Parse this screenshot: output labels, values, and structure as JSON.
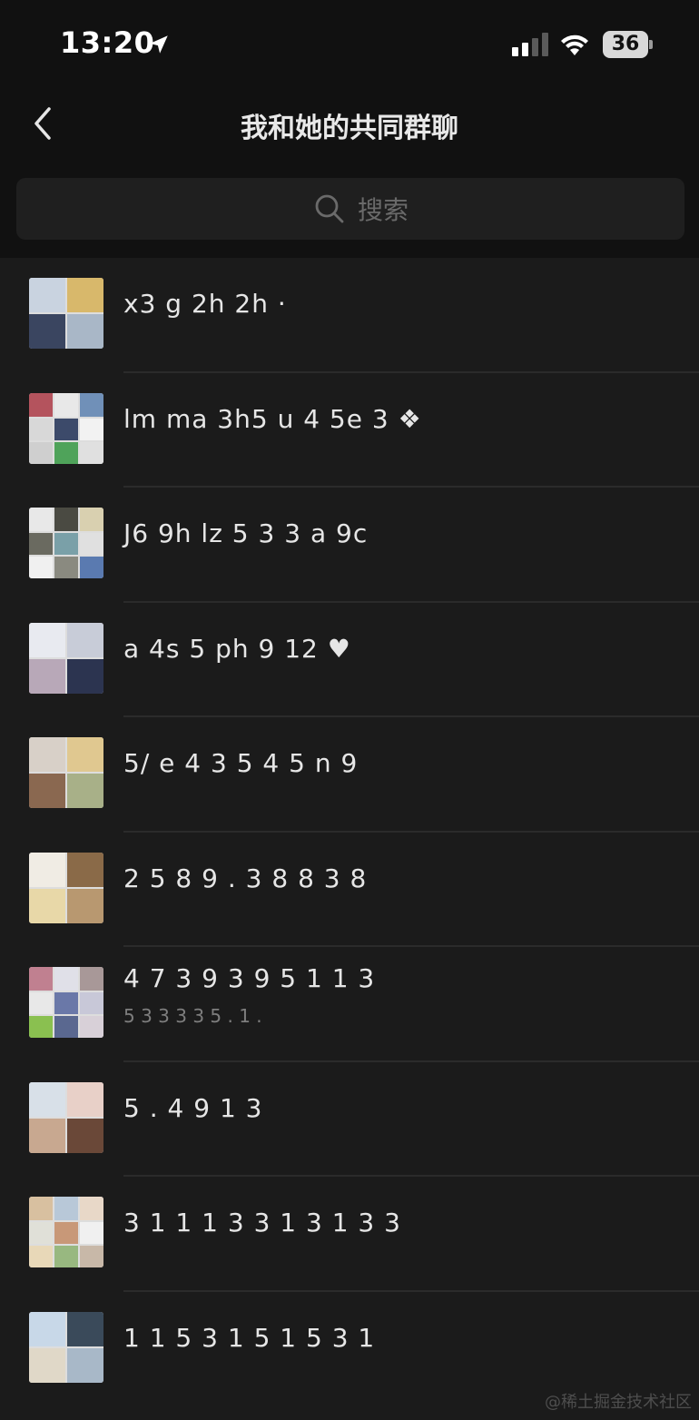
{
  "status_bar": {
    "time": "13:20",
    "battery_level": "36",
    "icons": [
      "location-arrow-icon",
      "cellular-signal-icon",
      "wifi-icon",
      "battery-icon"
    ]
  },
  "nav": {
    "title": "我和她的共同群聊",
    "back_icon": "chevron-left-icon"
  },
  "search": {
    "placeholder": "搜索",
    "icon": "search-icon"
  },
  "groups": [
    {
      "name": "x3 g 2h 2h  ·",
      "subtitle": ""
    },
    {
      "name": "lm ma 3h5 u 4 5e 3 ❖",
      "subtitle": ""
    },
    {
      "name": "J6 9h lz 5 3 3 a 9c",
      "subtitle": ""
    },
    {
      "name": "a 4s 5 ph 9 12 ♥",
      "subtitle": ""
    },
    {
      "name": "5/ e 4 3   5 4 5 n 9",
      "subtitle": ""
    },
    {
      "name": "2 5 8 9 . 3 8 8  3 8",
      "subtitle": ""
    },
    {
      "name": "4 7 3 9 3 9 5 1 1 3",
      "subtitle": "5 3 3 3 3 5 . 1 . "
    },
    {
      "name": "5 . 4 9 1 3",
      "subtitle": ""
    },
    {
      "name": "3 1 1 1 3 3 1 3 1 3 3",
      "subtitle": ""
    },
    {
      "name": "1 1 5 3 1 5 1 5 3 1",
      "subtitle": ""
    }
  ],
  "watermark": "@稀土掘金技术社区",
  "colors": {
    "background": "#1b1b1b",
    "header": "#111111",
    "search_box": "#1f1f1f",
    "divider": "#2b2b2b"
  }
}
